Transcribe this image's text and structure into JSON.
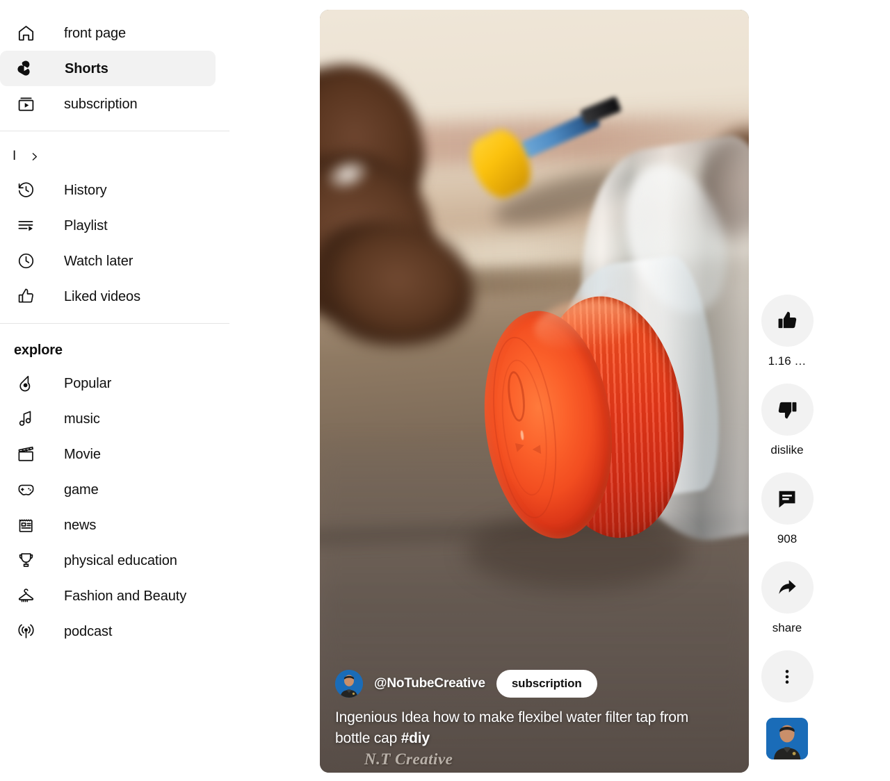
{
  "sidebar": {
    "primary": [
      {
        "label": "front page",
        "icon": "home-icon",
        "active": false
      },
      {
        "label": "Shorts",
        "icon": "shorts-icon",
        "active": true
      },
      {
        "label": "subscription",
        "icon": "subscriptions-icon",
        "active": false
      }
    ],
    "collapsed_row": {
      "label": "I",
      "icon": "chevron-right-icon"
    },
    "library": [
      {
        "label": "History",
        "icon": "history-icon"
      },
      {
        "label": "Playlist",
        "icon": "playlist-icon"
      },
      {
        "label": "Watch later",
        "icon": "clock-icon"
      },
      {
        "label": "Liked videos",
        "icon": "thumbs-up-outline-icon"
      }
    ],
    "explore_heading": "explore",
    "explore": [
      {
        "label": "Popular",
        "icon": "trending-flame-icon"
      },
      {
        "label": "music",
        "icon": "music-note-icon"
      },
      {
        "label": "Movie",
        "icon": "clapperboard-icon"
      },
      {
        "label": "game",
        "icon": "gamepad-icon"
      },
      {
        "label": "news",
        "icon": "newspaper-icon"
      },
      {
        "label": "physical education",
        "icon": "trophy-icon"
      },
      {
        "label": "Fashion and Beauty",
        "icon": "hanger-icon"
      },
      {
        "label": "podcast",
        "icon": "podcast-icon"
      }
    ]
  },
  "player": {
    "channel_handle": "@NoTubeCreative",
    "subscribe_label": "subscription",
    "title_part1": "Ingenious Idea how to make flexibel water filter tap from bottle cap ",
    "title_hashtag": "#diy",
    "watermark": "N.T Creative",
    "avatar_name": "channel-avatar"
  },
  "actions": [
    {
      "name": "like",
      "icon": "thumbs-up-filled-icon",
      "label": "1.16 …"
    },
    {
      "name": "dislike",
      "icon": "thumbs-down-filled-icon",
      "label": "dislike"
    },
    {
      "name": "comments",
      "icon": "comment-bubble-icon",
      "label": "908"
    },
    {
      "name": "share",
      "icon": "share-arrow-icon",
      "label": "share"
    },
    {
      "name": "more",
      "icon": "more-vertical-icon",
      "label": ""
    }
  ],
  "colors": {
    "accent_surface": "#f2f2f2",
    "text": "#0f0f0f",
    "divider": "#e5e5e5",
    "avatar_blue": "#1a6cb8",
    "cap_red": "#f24d20"
  }
}
